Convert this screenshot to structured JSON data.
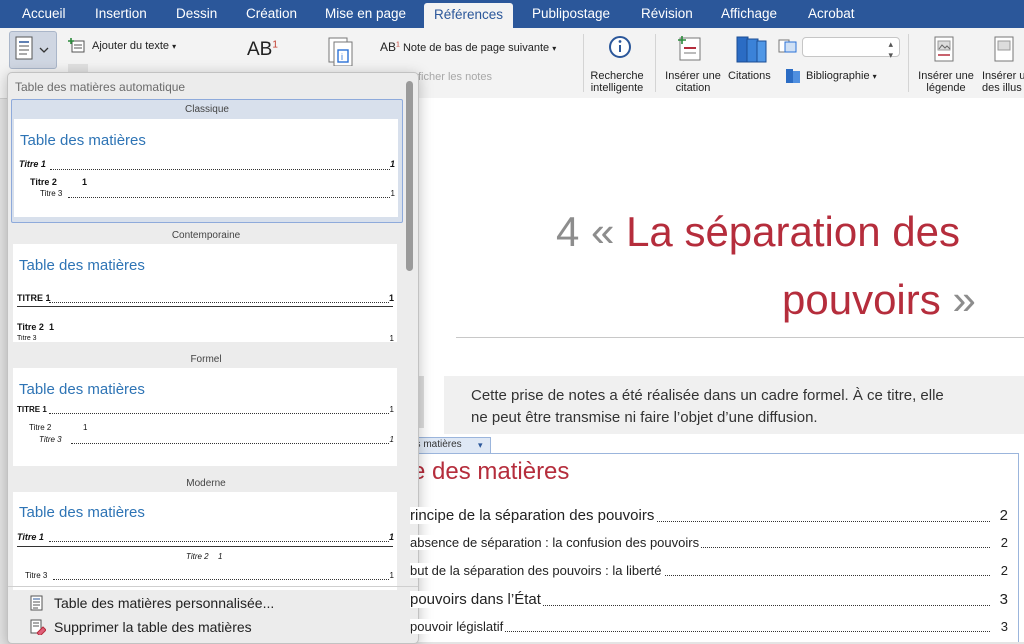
{
  "tabs": [
    "Accueil",
    "Insertion",
    "Dessin",
    "Création",
    "Mise en page",
    "Références",
    "Publipostage",
    "Révision",
    "Affichage",
    "Acrobat"
  ],
  "active_tab": "Références",
  "colors": {
    "tabbar": "#2b579a",
    "accent_red": "#b52d3c",
    "toc_blue": "#2e74b5"
  },
  "ribbon": {
    "add_text": "Ajouter du texte",
    "footnote_icon": "AB",
    "footnote_superscript": "1",
    "endnote_icon": "AB",
    "endnote_superscript": "1",
    "next_footnote": "Note de bas de page suivante",
    "show_notes": "ficher les notes",
    "smart_lookup_line1": "Recherche",
    "smart_lookup_line2": "intelligente",
    "insert_citation_line1": "Insérer une",
    "insert_citation_line2": "citation",
    "citations": "Citations",
    "bibliography": "Bibliographie",
    "insert_caption_line1": "Insérer une",
    "insert_caption_line2": "légende",
    "insert_table_line1": "Insérer u",
    "insert_table_line2": "des illus"
  },
  "gallery": {
    "header": "Table des matières automatique",
    "styles": [
      {
        "label": "Classique",
        "title": "Table des matières",
        "row1": "Titre 1",
        "row2": "Titre 2",
        "row2_num": "1",
        "row3": "Titre 3",
        "page": "1"
      },
      {
        "label": "Contemporaine",
        "title": "Table des matières",
        "row1": "TITRE 1",
        "row2": "Titre 2",
        "row2_num": "1",
        "row3": "Titre 3",
        "page": "1"
      },
      {
        "label": "Formel",
        "title": "Table des matières",
        "row1": "TITRE 1",
        "row2": "Titre 2",
        "row2_num": "1",
        "row3": "Titre 3",
        "page": "1"
      },
      {
        "label": "Moderne",
        "title": "Table des matières",
        "row1": "Titre 1",
        "row2": "Titre 2",
        "row2_num": "1",
        "row3": "Titre 3",
        "page": "1"
      }
    ],
    "custom": "Table des matières personnalisée...",
    "delete": "Supprimer la table des matières"
  },
  "document": {
    "chapter_number": "4",
    "chapter_open": "«",
    "chapter_title_1": "La séparation des",
    "chapter_title_2": "pouvoirs",
    "chapter_close": "»",
    "notice_line1": "Cette prise de notes a été réalisée dans un cadre formel. À ce titre, elle",
    "notice_line2": "ne peut être transmise ni faire l’objet d’une diffusion.",
    "toc_tag": "es matières",
    "toc_heading": "e des matières",
    "entries": [
      {
        "text": "rincipe de la séparation des pouvoirs",
        "page": "2"
      },
      {
        "text": "absence de séparation : la confusion des pouvoirs",
        "page": "2"
      },
      {
        "text": "but de la séparation des pouvoirs : la liberté",
        "page": "2"
      },
      {
        "text": "pouvoirs dans l’État",
        "page": "3"
      },
      {
        "text": "pouvoir législatif",
        "page": "3"
      }
    ]
  }
}
